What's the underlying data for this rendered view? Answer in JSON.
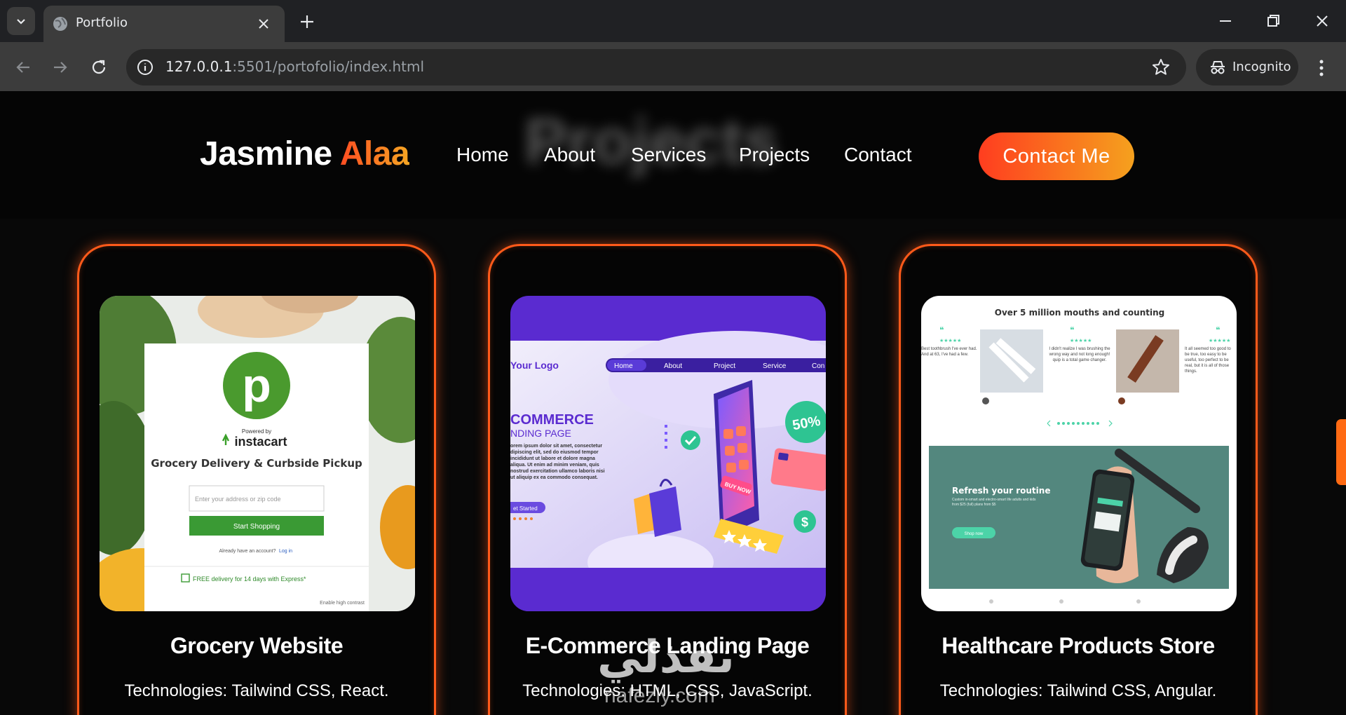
{
  "browser": {
    "tab_title": "Portfolio",
    "url_host": "127.0.0.1",
    "url_rest": ":5501/portofolio/index.html",
    "incognito_label": "Incognito"
  },
  "site": {
    "ghost_heading": "Projects",
    "logo_first": "Jasmine",
    "logo_last": "Alaa",
    "nav": [
      "Home",
      "About",
      "Services",
      "Projects",
      "Contact"
    ],
    "cta_label": "Contact Me",
    "accent_colors": [
      "#ff3d1f",
      "#f5a11e"
    ]
  },
  "projects": [
    {
      "title": "Grocery Website",
      "tech": "Technologies: Tailwind CSS, React.",
      "thumb": {
        "powered_by": "Powered by",
        "brand": "instacart",
        "headline": "Grocery Delivery & Curbside Pickup",
        "input_placeholder": "Enter your address or zip code",
        "button": "Start Shopping",
        "login_prompt": "Already have an account?",
        "login_link": "Log in",
        "promo": "FREE delivery for 14 days with Express*",
        "contrast": "Enable high contrast",
        "logo_letter": "p"
      }
    },
    {
      "title": "E-Commerce Landing Page",
      "tech": "Technologies: HTML, CSS, JavaScript.",
      "thumb": {
        "logo": "Your Logo",
        "menu": [
          "Home",
          "About",
          "Project",
          "Service",
          "Con"
        ],
        "headline": "COMMERCE",
        "subhead": "NDING PAGE",
        "body": "orem ipsum dolor sit amet, consectetur dipiscing elit, sed do eiusmod tempor incididunt ut labore et dolore magna aliqua. Ut enim ad minim veniam, quis nostrud exercitation ullamco laboris nisi ut aliquip ex ea commodo consequat.",
        "button": "et Started",
        "badge": "50%",
        "buy": "BUY NOW",
        "dollar": "$"
      }
    },
    {
      "title": "Healthcare Products Store",
      "tech": "Technologies: Tailwind CSS, Angular.",
      "thumb": {
        "heading": "Over 5 million mouths and counting",
        "quotes": [
          "Best toothbrush I've ever had. And at 63, I've had a few.",
          "I didn't realize I was brushing the wrong way and not long enough! quip is a total game changer.",
          "It all seemed too good to be true, too easy to be useful, too perfect to be real, but it is all of those things."
        ],
        "banner_title": "Refresh your routine",
        "banner_body": "Custom in-smart and electro-smart life adults and kids from $25 (full) plans from $5",
        "banner_button": "Shop now"
      }
    }
  ],
  "watermark": {
    "arabic": "نفذلي",
    "latin": "nafezly.com"
  }
}
